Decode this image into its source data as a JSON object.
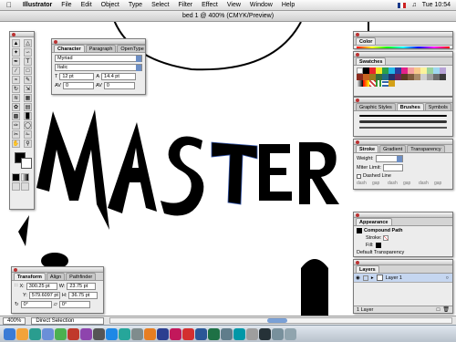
{
  "menubar": {
    "app_name": "Illustrator",
    "items": [
      "File",
      "Edit",
      "Object",
      "Type",
      "Select",
      "Filter",
      "Effect",
      "View",
      "Window",
      "Help"
    ],
    "clock": "Tue 10:54"
  },
  "document": {
    "title": "bed 1 @ 400% (CMYK/Preview)"
  },
  "artwork": {
    "text": "MASTER"
  },
  "character_panel": {
    "tabs": [
      "Character",
      "Paragraph",
      "OpenType"
    ],
    "font_family": "Myriad",
    "font_style": "Italic",
    "size": "12 pt",
    "leading": "14.4 pt",
    "tracking_left": "0",
    "tracking_right": "0"
  },
  "transform_panel": {
    "tabs": [
      "Transform",
      "Align",
      "Pathfinder"
    ],
    "x_label": "X:",
    "x_value": "300.25 pt",
    "y_label": "Y:",
    "y_value": "579.6097 pt",
    "w_label": "W:",
    "w_value": "23.75 pt",
    "h_label": "H:",
    "h_value": "36.75 pt",
    "rotate": "0°",
    "shear": "0°"
  },
  "color_panel": {
    "title": "Color"
  },
  "swatches_panel": {
    "title": "Swatches"
  },
  "brushes_panel": {
    "tabs": [
      "Graphic Styles",
      "Brushes",
      "Symbols"
    ]
  },
  "stroke_panel": {
    "tabs": [
      "Stroke",
      "Gradient",
      "Transparency"
    ],
    "weight_label": "Weight:",
    "miter_label": "Miter Limit:",
    "dashed_label": "Dashed Line",
    "dash_labels": [
      "dash",
      "gap",
      "dash",
      "gap",
      "dash",
      "gap"
    ]
  },
  "appearance_panel": {
    "title": "Appearance",
    "object": "Compound Path",
    "stroke_label": "Stroke:",
    "fill_label": "Fill:",
    "transparency": "Default Transparency"
  },
  "layers_panel": {
    "title": "Layers",
    "layer_name": "Layer 1",
    "footer": "1 Layer"
  },
  "statusbar": {
    "zoom": "400%",
    "tool": "Direct Selection"
  },
  "dock": {
    "icons": [
      "finder-icon",
      "app-icon",
      "browser-icon",
      "mail-icon",
      "ichat-icon",
      "itunes-icon",
      "iphoto-icon",
      "imovie-icon",
      "idvd-icon",
      "safari-icon",
      "pref-icon",
      "illustrator-icon",
      "photoshop-icon",
      "indesign-icon",
      "acrobat-icon",
      "word-icon",
      "excel-icon",
      "quicktime-icon",
      "preview-icon",
      "textedit-icon",
      "terminal-icon",
      "folder-icon",
      "trash-icon"
    ]
  }
}
